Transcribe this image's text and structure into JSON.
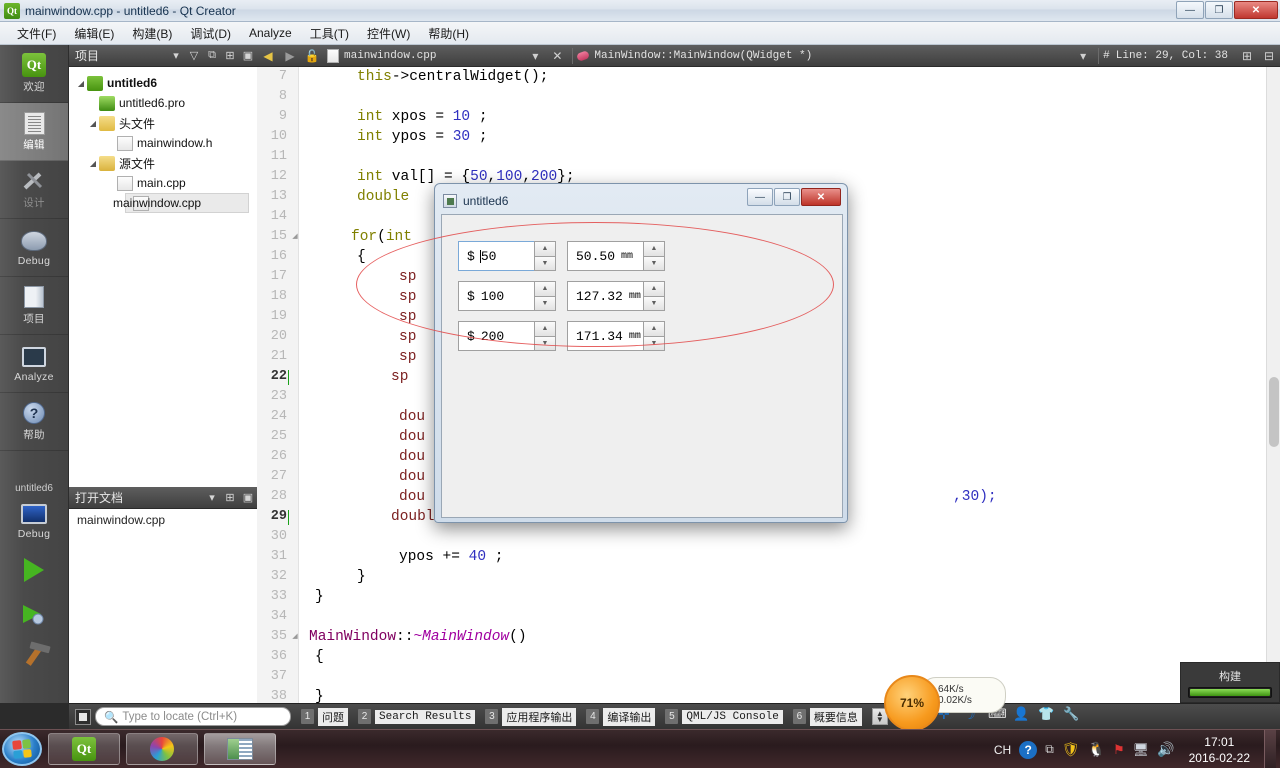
{
  "window": {
    "title": "mainwindow.cpp - untitled6 - Qt Creator",
    "icon": "qt-logo-icon",
    "buttons": {
      "minimize": "—",
      "maximize": "❐",
      "close": "✕"
    }
  },
  "menubar": {
    "items": [
      "文件(F)",
      "编辑(E)",
      "构建(B)",
      "调试(D)",
      "Analyze",
      "工具(T)",
      "控件(W)",
      "帮助(H)"
    ]
  },
  "modebar": {
    "modes": [
      {
        "label": "欢迎",
        "icon": "qt-welcome-icon",
        "state": "normal"
      },
      {
        "label": "编辑",
        "icon": "edit-document-icon",
        "state": "active"
      },
      {
        "label": "设计",
        "icon": "design-tools-icon",
        "state": "disabled"
      },
      {
        "label": "Debug",
        "icon": "debug-bug-icon",
        "state": "normal"
      },
      {
        "label": "项目",
        "icon": "projects-folder-icon",
        "state": "normal"
      },
      {
        "label": "Analyze",
        "icon": "analyze-grid-icon",
        "state": "normal"
      },
      {
        "label": "帮助",
        "icon": "help-question-icon",
        "state": "normal"
      }
    ],
    "kit": {
      "project": "untitled6",
      "build_config": "Debug"
    },
    "run_button": "run-green-triangle-icon",
    "debug_button": "debug-run-icon",
    "build_button": "build-hammer-icon"
  },
  "sidepanel": {
    "projects_header": {
      "title": "项目",
      "filter_icon": "filter-icon",
      "link_icon": "link-icon",
      "split_icon": "split-icon",
      "close_icon": "close-icon",
      "dropdown_icon": "chevron-down-icon"
    },
    "tree": [
      {
        "label": "untitled6",
        "icon": "qt-project-icon",
        "depth": 0,
        "expanded": true,
        "bold": true,
        "selected": false
      },
      {
        "label": "untitled6.pro",
        "icon": "qt-pro-file-icon",
        "depth": 1,
        "expanded": null,
        "bold": false,
        "selected": false
      },
      {
        "label": "头文件",
        "icon": "header-folder-icon",
        "depth": 1,
        "expanded": true,
        "bold": false,
        "selected": false
      },
      {
        "label": "mainwindow.h",
        "icon": "file-icon",
        "depth": 2,
        "expanded": null,
        "bold": false,
        "selected": false
      },
      {
        "label": "源文件",
        "icon": "source-folder-icon",
        "depth": 1,
        "expanded": true,
        "bold": false,
        "selected": false
      },
      {
        "label": "main.cpp",
        "icon": "file-icon",
        "depth": 2,
        "expanded": null,
        "bold": false,
        "selected": false
      },
      {
        "label": "mainwindow.cpp",
        "icon": "file-icon",
        "depth": 2,
        "expanded": null,
        "bold": false,
        "selected": true
      }
    ],
    "opendocs_header": {
      "title": "打开文档",
      "dropdown_icon": "chevron-down-icon",
      "split_icon": "split-icon",
      "close_icon": "close-icon"
    },
    "opendocs": [
      "mainwindow.cpp"
    ]
  },
  "editor": {
    "toolbar": {
      "back_icon": "back-arrow-icon",
      "forward_icon": "forward-arrow-icon",
      "lock_icon": "unlock-icon",
      "file_icon": "file-icon",
      "filename": "mainwindow.cpp",
      "file_dropdown_icon": "chevron-down-icon",
      "close_icon": "close-icon",
      "symbol_icon": "symbol-method-icon",
      "symbol": "MainWindow::MainWindow(QWidget *)",
      "symbol_dropdown_icon": "chevron-down-icon",
      "line_col_icon": "line-number-icon",
      "line_col": "Line: 29, Col: 38",
      "split_icon": "split-icon"
    },
    "first_line": 7,
    "lines": [
      {
        "n": 7,
        "text": "this->centralWidget();",
        "indent": 4,
        "fold": false,
        "current": false
      },
      {
        "n": 8,
        "text": "",
        "indent": 0,
        "fold": false,
        "current": false
      },
      {
        "n": 9,
        "text": "int xpos = 10 ;",
        "indent": 4,
        "fold": false,
        "current": false
      },
      {
        "n": 10,
        "text": "int ypos = 30 ;",
        "indent": 4,
        "fold": false,
        "current": false
      },
      {
        "n": 11,
        "text": "",
        "indent": 0,
        "fold": false,
        "current": false
      },
      {
        "n": 12,
        "text": "int val[] = {50,100,200};",
        "indent": 4,
        "fold": false,
        "current": false
      },
      {
        "n": 13,
        "text": "double",
        "indent": 4,
        "fold": false,
        "current": false
      },
      {
        "n": 14,
        "text": "",
        "indent": 0,
        "fold": false,
        "current": false
      },
      {
        "n": 15,
        "text": "for(int",
        "indent": 4,
        "fold": true,
        "current": false
      },
      {
        "n": 16,
        "text": "{",
        "indent": 4,
        "fold": false,
        "current": false
      },
      {
        "n": 17,
        "text": "sp",
        "indent": 8,
        "fold": false,
        "current": false
      },
      {
        "n": 18,
        "text": "sp",
        "indent": 8,
        "fold": false,
        "current": false
      },
      {
        "n": 19,
        "text": "sp",
        "indent": 8,
        "fold": false,
        "current": false
      },
      {
        "n": 20,
        "text": "sp",
        "indent": 8,
        "fold": false,
        "current": false
      },
      {
        "n": 21,
        "text": "sp",
        "indent": 8,
        "fold": false,
        "current": false
      },
      {
        "n": 22,
        "text": "sp",
        "indent": 8,
        "fold": false,
        "current": true
      },
      {
        "n": 23,
        "text": "",
        "indent": 0,
        "fold": false,
        "current": false
      },
      {
        "n": 24,
        "text": "dou",
        "indent": 8,
        "fold": false,
        "current": false
      },
      {
        "n": 25,
        "text": "dou",
        "indent": 8,
        "fold": false,
        "current": false
      },
      {
        "n": 26,
        "text": "dou",
        "indent": 8,
        "fold": false,
        "current": false
      },
      {
        "n": 27,
        "text": "dou",
        "indent": 8,
        "fold": false,
        "current": false
      },
      {
        "n": 28,
        "text": "dou",
        "indent": 8,
        "fold": false,
        "current": false
      },
      {
        "n": 29,
        "text": "doublespin[i]->setSuffix( \" mm\" );",
        "indent": 8,
        "fold": false,
        "current": true
      },
      {
        "n": 30,
        "text": "",
        "indent": 0,
        "fold": false,
        "current": false
      },
      {
        "n": 31,
        "text": "ypos += 40 ;",
        "indent": 8,
        "fold": false,
        "current": false
      },
      {
        "n": 32,
        "text": "}",
        "indent": 4,
        "fold": false,
        "current": false
      },
      {
        "n": 33,
        "text": "}",
        "indent": 0,
        "fold": false,
        "current": false
      },
      {
        "n": 34,
        "text": "",
        "indent": 0,
        "fold": false,
        "current": false
      },
      {
        "n": 35,
        "text": "MainWindow::~MainWindow()",
        "indent": 0,
        "fold": true,
        "current": false
      },
      {
        "n": 36,
        "text": "{",
        "indent": 0,
        "fold": false,
        "current": false
      },
      {
        "n": 37,
        "text": "",
        "indent": 0,
        "fold": false,
        "current": false
      },
      {
        "n": 38,
        "text": "}",
        "indent": 0,
        "fold": false,
        "current": false
      }
    ],
    "tail_fragment_30": ",30);"
  },
  "app_dialog": {
    "title": "untitled6",
    "icon": "app-window-icon",
    "buttons": {
      "minimize": "—",
      "maximize": "❐",
      "close": "✕"
    },
    "spinboxes": [
      {
        "prefix": "$",
        "value": "50",
        "suffix": "",
        "focused": true,
        "col": 0,
        "row": 0
      },
      {
        "prefix": "",
        "value": "50.50",
        "suffix": "mm",
        "focused": false,
        "col": 1,
        "row": 0
      },
      {
        "prefix": "$",
        "value": "100",
        "suffix": "",
        "focused": false,
        "col": 0,
        "row": 1
      },
      {
        "prefix": "",
        "value": "127.32",
        "suffix": "mm",
        "focused": false,
        "col": 1,
        "row": 1
      },
      {
        "prefix": "$",
        "value": "200",
        "suffix": "",
        "focused": false,
        "col": 0,
        "row": 2
      },
      {
        "prefix": "",
        "value": "171.34",
        "suffix": "mm",
        "focused": false,
        "col": 1,
        "row": 2
      }
    ],
    "up_glyph": "▲",
    "down_glyph": "▼"
  },
  "annotation": {
    "shape": "red-ellipse-highlight",
    "color": "#e24545"
  },
  "outputbar": {
    "toggle_icon": "output-toggle-icon",
    "locator_placeholder": "Type to locate (Ctrl+K)",
    "locator_icon": "search-icon",
    "panes": [
      {
        "key": "1",
        "label": "问题",
        "cn": true
      },
      {
        "key": "2",
        "label": "Search Results",
        "cn": false
      },
      {
        "key": "3",
        "label": "应用程序输出",
        "cn": true
      },
      {
        "key": "4",
        "label": "编译输出",
        "cn": true
      },
      {
        "key": "5",
        "label": "QML/JS Console",
        "cn": false
      },
      {
        "key": "6",
        "label": "概要信息",
        "cn": true
      }
    ],
    "updown_icon": "up-down-arrows-icon"
  },
  "build_progress": {
    "label": "构建",
    "percent": 100,
    "color": "#6cc231"
  },
  "net_widget": {
    "percent": "71%",
    "upload": "64K/s",
    "download": "0.02K/s",
    "up_icon": "arrow-up-icon",
    "down_icon": "arrow-down-icon"
  },
  "tray_inline_icons": [
    "plus-icon",
    "moon-icon",
    "keyboard-icon",
    "contact-icon",
    "shirt-icon",
    "wrench-icon"
  ],
  "taskbar": {
    "start_icon": "windows-start-orb",
    "items": [
      {
        "icon": "qt-creator-taskbar-icon",
        "active": false
      },
      {
        "icon": "color-wheel-icon",
        "active": false
      },
      {
        "icon": "app-window-taskbar-icon",
        "active": true
      }
    ],
    "tray": {
      "ime": "CH",
      "icons": [
        "help-circle-icon",
        "show-hidden-icon",
        "security-shield-icon",
        "penguin-icon",
        "flag-error-icon",
        "network-icon",
        "volume-icon"
      ],
      "time": "17:01",
      "date": "2016-02-22"
    }
  }
}
